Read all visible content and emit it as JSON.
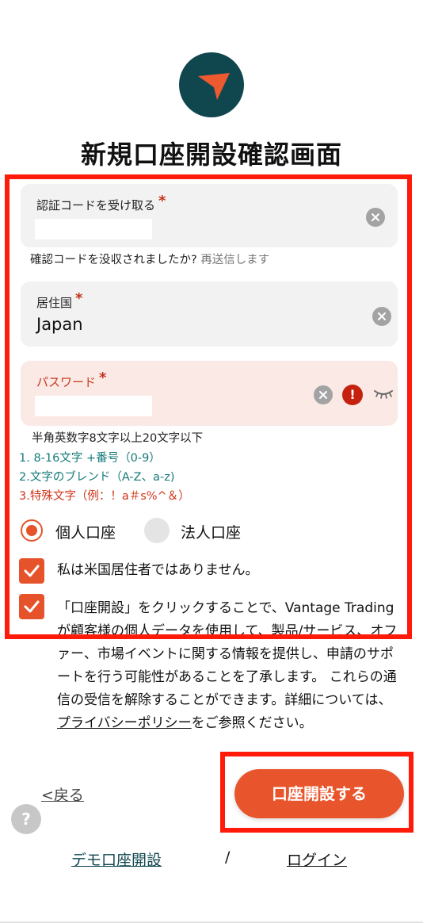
{
  "page": {
    "title": "新規口座開設確認画面"
  },
  "verification": {
    "label": "認証コードを受け取る",
    "required_mark": "*",
    "note": "確認コードを没収されましたか?",
    "resend_label": "再送信します"
  },
  "country": {
    "label": "居住国",
    "required_mark": "*",
    "value": "Japan"
  },
  "password": {
    "label": "パスワード",
    "required_mark": "*",
    "hint": "半角英数字8文字以上20文字以下",
    "rules": [
      {
        "text": "1. 8-16文字 +番号（0-9）",
        "status": "ok"
      },
      {
        "text": "2.文字のブレンド（A-Z、a-z)",
        "status": "ok"
      },
      {
        "text": "3.特殊文字（例：！a＃s%^＆）",
        "status": "error"
      }
    ],
    "error_icon": "!"
  },
  "account_type": {
    "options": [
      "個人口座",
      "法人口座"
    ],
    "selected": "個人口座"
  },
  "checks": {
    "us_resident_label": "私は米国居住者ではありません。",
    "consent_text": "「口座開設」をクリックすることで、Vantage Trading が顧客様の個人データを使用して、製品/サービス、オファー、市場イベントに関する情報を提供し、申請のサポートを行う可能性があることを了承します。 これらの通信の受信を解除することができます。詳細については、",
    "privacy_link": "プライバシーポリシー",
    "consent_suffix": "をご参照ください。"
  },
  "actions": {
    "back_label": "<戻る",
    "submit_label": "口座開設する",
    "help_label": "?"
  },
  "footer": {
    "demo_link": "デモ口座開設",
    "separator": "/",
    "login_link": "ログイン"
  },
  "colors": {
    "brand_dark": "#10474f",
    "accent": "#e8552c",
    "rule_ok": "#177a7a",
    "rule_error": "#d0341a",
    "highlight_box": "#ff1a0a"
  }
}
